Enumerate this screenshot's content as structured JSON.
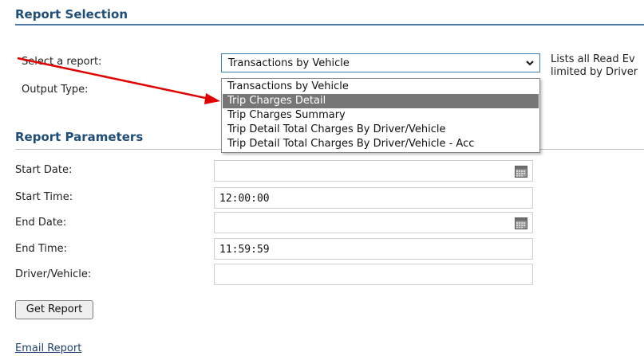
{
  "report_selection": {
    "title": "Report Selection",
    "select_label": "Select a report:",
    "selected_report": "Transactions by Vehicle",
    "output_type_label": "Output Type:",
    "description_line1": "Lists all Read Ev",
    "description_line2": "limited by Driver"
  },
  "dropdown": {
    "options": [
      "Transactions by Vehicle",
      "Trip Charges Detail",
      "Trip Charges Summary",
      "Trip Detail Total Charges By Driver/Vehicle",
      "Trip Detail Total Charges By Driver/Vehicle - Acc"
    ],
    "highlighted_option": "Trip Charges Detail"
  },
  "report_parameters": {
    "title": "Report Parameters",
    "start_date_label": "Start Date:",
    "start_date_value": "",
    "start_time_label": "Start Time:",
    "start_time_value": "12:00:00",
    "end_date_label": "End Date:",
    "end_date_value": "",
    "end_time_label": "End Time:",
    "end_time_value": "11:59:59",
    "driver_vehicle_label": "Driver/Vehicle:",
    "driver_vehicle_value": ""
  },
  "actions": {
    "get_report_label": "Get Report",
    "email_report_label": "Email Report"
  },
  "icons": {
    "calendar": "calendar-icon",
    "chevron": "chevron-down-icon",
    "annotation": "red-arrow"
  },
  "colors": {
    "heading": "#1f4e79",
    "highlight": "#767676",
    "annotation_arrow": "#e00000"
  }
}
